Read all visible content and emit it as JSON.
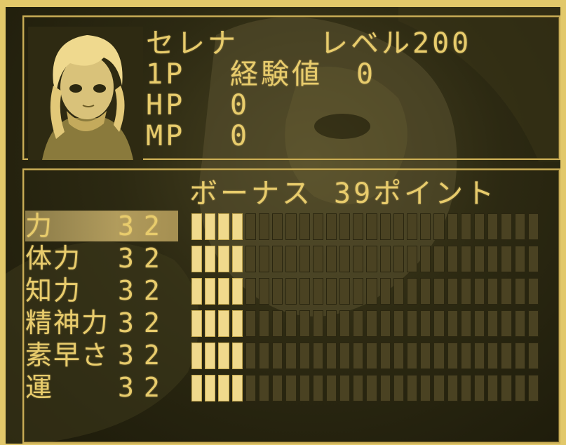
{
  "character": {
    "name": "セレナ",
    "level_label": "レベル200",
    "player_label": "1P",
    "exp_label": "経験値",
    "exp_value": "0",
    "hp_label": "HP",
    "hp_value": "0",
    "mp_label": "MP",
    "mp_value": "0"
  },
  "bonus": {
    "label": "ボーナス",
    "points": "39ポイント"
  },
  "stats": [
    {
      "name": "力",
      "value": "32",
      "level": 4,
      "max": 26,
      "selected": true
    },
    {
      "name": "体力",
      "value": "32",
      "level": 4,
      "max": 26,
      "selected": false
    },
    {
      "name": "知力",
      "value": "32",
      "level": 4,
      "max": 26,
      "selected": false
    },
    {
      "name": "精神力",
      "value": "32",
      "level": 4,
      "max": 26,
      "selected": false
    },
    {
      "name": "素早さ",
      "value": "32",
      "level": 4,
      "max": 26,
      "selected": false
    },
    {
      "name": "運",
      "value": "32",
      "level": 4,
      "max": 26,
      "selected": false
    }
  ],
  "colors": {
    "text": "#e8cc6c",
    "filled_cell": "#f0d98c",
    "empty_cell": "#4a4222",
    "highlight": "#c9b06a"
  }
}
